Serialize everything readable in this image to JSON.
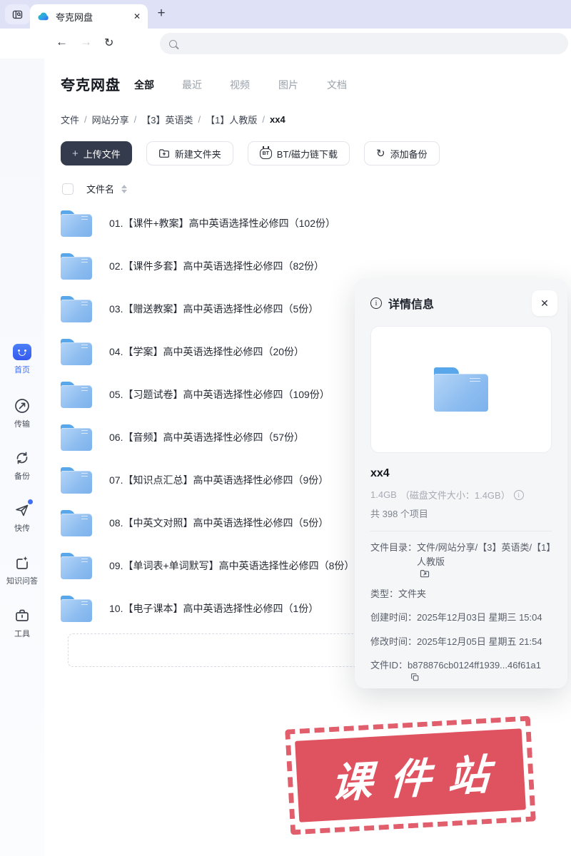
{
  "icons": {
    "plus": "+",
    "close": "✕",
    "back": "←",
    "forward": "→",
    "refresh": "↻",
    "new_tab": "+"
  },
  "browser": {
    "tab_title": "夸克网盘"
  },
  "header": {
    "app_title": "夸克网盘",
    "tabs": [
      {
        "label": "全部",
        "active": true
      },
      {
        "label": "最近",
        "active": false
      },
      {
        "label": "视频",
        "active": false
      },
      {
        "label": "图片",
        "active": false
      },
      {
        "label": "文档",
        "active": false
      }
    ]
  },
  "breadcrumb": {
    "parts": [
      "文件",
      "网站分享",
      "【3】英语类",
      "【1】人教版"
    ],
    "separator": "/",
    "current": "xx4"
  },
  "actions": {
    "upload": "上传文件",
    "new_folder": "新建文件夹",
    "bt_download": "BT/磁力链下载",
    "bt_icon_text": "BT",
    "add_backup": "添加备份"
  },
  "list": {
    "header": "文件名"
  },
  "files": [
    {
      "name": "01.【课件+教案】高中英语选择性必修四（102份）"
    },
    {
      "name": "02.【课件多套】高中英语选择性必修四（82份）"
    },
    {
      "name": "03.【赠送教案】高中英语选择性必修四（5份）"
    },
    {
      "name": "04.【学案】高中英语选择性必修四（20份）"
    },
    {
      "name": "05.【习题试卷】高中英语选择性必修四（109份）"
    },
    {
      "name": "06.【音频】高中英语选择性必修四（57份）"
    },
    {
      "name": "07.【知识点汇总】高中英语选择性必修四（9份）"
    },
    {
      "name": "08.【中英文对照】高中英语选择性必修四（5份）"
    },
    {
      "name": "09.【单词表+单词默写】高中英语选择性必修四（8份）"
    },
    {
      "name": "10.【电子课本】高中英语选择性必修四（1份）"
    }
  ],
  "sidebar": {
    "items": [
      {
        "label": "首页",
        "active": true
      },
      {
        "label": "传输",
        "active": false
      },
      {
        "label": "备份",
        "active": false
      },
      {
        "label": "快传",
        "active": false,
        "badge": true
      },
      {
        "label": "知识问答",
        "active": false
      },
      {
        "label": "工具",
        "active": false
      }
    ]
  },
  "detail": {
    "title": "详情信息",
    "name": "xx4",
    "size_value": "1.4GB",
    "size_note": "（磁盘文件大小：1.4GB）",
    "items_count": "共 398 个项目",
    "dir_label": "文件目录：",
    "dir_value": "文件/网站分享/【3】英语类/【1】人教版",
    "type_label": "类型：",
    "type_value": "文件夹",
    "created_label": "创建时间：",
    "created_value": "2025年12月03日 星期三 15:04",
    "modified_label": "修改时间：",
    "modified_value": "2025年12月05日 星期五 21:54",
    "id_label": "文件ID：",
    "id_value": "b878876cb0124ff1939...46f61a1"
  },
  "watermark": {
    "text": "课件站"
  },
  "colors": {
    "accent": "#3f6df4",
    "tabstrip": "#dfe2f7",
    "dark_button": "#343b4d",
    "folder_tab": "#58a7ea",
    "folder_body": "#8cbcf0",
    "panel_bg": "#f5f6f8",
    "stamp_red": "#df5260"
  }
}
